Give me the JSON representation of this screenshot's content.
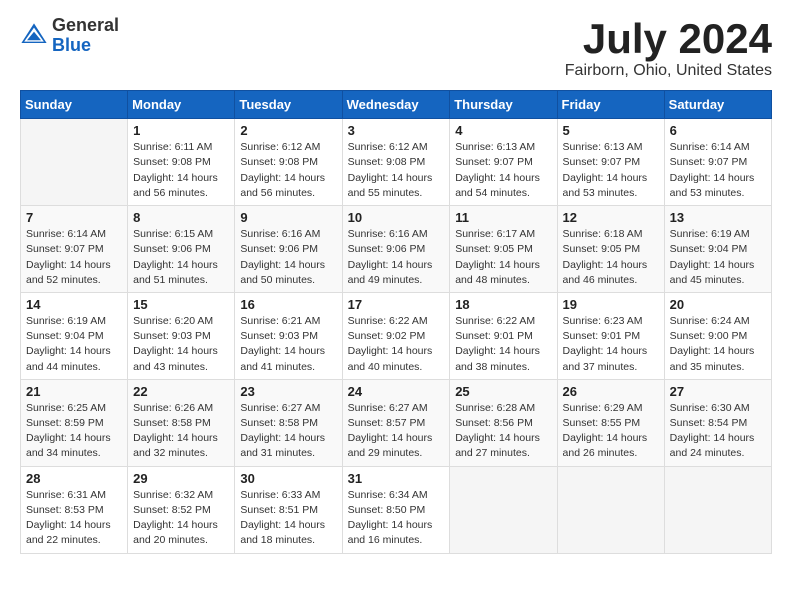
{
  "logo": {
    "text_general": "General",
    "text_blue": "Blue"
  },
  "header": {
    "month_year": "July 2024",
    "location": "Fairborn, Ohio, United States"
  },
  "columns": [
    "Sunday",
    "Monday",
    "Tuesday",
    "Wednesday",
    "Thursday",
    "Friday",
    "Saturday"
  ],
  "weeks": [
    [
      {
        "day": "",
        "sunrise": "",
        "sunset": "",
        "daylight": ""
      },
      {
        "day": "1",
        "sunrise": "Sunrise: 6:11 AM",
        "sunset": "Sunset: 9:08 PM",
        "daylight": "Daylight: 14 hours and 56 minutes."
      },
      {
        "day": "2",
        "sunrise": "Sunrise: 6:12 AM",
        "sunset": "Sunset: 9:08 PM",
        "daylight": "Daylight: 14 hours and 56 minutes."
      },
      {
        "day": "3",
        "sunrise": "Sunrise: 6:12 AM",
        "sunset": "Sunset: 9:08 PM",
        "daylight": "Daylight: 14 hours and 55 minutes."
      },
      {
        "day": "4",
        "sunrise": "Sunrise: 6:13 AM",
        "sunset": "Sunset: 9:07 PM",
        "daylight": "Daylight: 14 hours and 54 minutes."
      },
      {
        "day": "5",
        "sunrise": "Sunrise: 6:13 AM",
        "sunset": "Sunset: 9:07 PM",
        "daylight": "Daylight: 14 hours and 53 minutes."
      },
      {
        "day": "6",
        "sunrise": "Sunrise: 6:14 AM",
        "sunset": "Sunset: 9:07 PM",
        "daylight": "Daylight: 14 hours and 53 minutes."
      }
    ],
    [
      {
        "day": "7",
        "sunrise": "Sunrise: 6:14 AM",
        "sunset": "Sunset: 9:07 PM",
        "daylight": "Daylight: 14 hours and 52 minutes."
      },
      {
        "day": "8",
        "sunrise": "Sunrise: 6:15 AM",
        "sunset": "Sunset: 9:06 PM",
        "daylight": "Daylight: 14 hours and 51 minutes."
      },
      {
        "day": "9",
        "sunrise": "Sunrise: 6:16 AM",
        "sunset": "Sunset: 9:06 PM",
        "daylight": "Daylight: 14 hours and 50 minutes."
      },
      {
        "day": "10",
        "sunrise": "Sunrise: 6:16 AM",
        "sunset": "Sunset: 9:06 PM",
        "daylight": "Daylight: 14 hours and 49 minutes."
      },
      {
        "day": "11",
        "sunrise": "Sunrise: 6:17 AM",
        "sunset": "Sunset: 9:05 PM",
        "daylight": "Daylight: 14 hours and 48 minutes."
      },
      {
        "day": "12",
        "sunrise": "Sunrise: 6:18 AM",
        "sunset": "Sunset: 9:05 PM",
        "daylight": "Daylight: 14 hours and 46 minutes."
      },
      {
        "day": "13",
        "sunrise": "Sunrise: 6:19 AM",
        "sunset": "Sunset: 9:04 PM",
        "daylight": "Daylight: 14 hours and 45 minutes."
      }
    ],
    [
      {
        "day": "14",
        "sunrise": "Sunrise: 6:19 AM",
        "sunset": "Sunset: 9:04 PM",
        "daylight": "Daylight: 14 hours and 44 minutes."
      },
      {
        "day": "15",
        "sunrise": "Sunrise: 6:20 AM",
        "sunset": "Sunset: 9:03 PM",
        "daylight": "Daylight: 14 hours and 43 minutes."
      },
      {
        "day": "16",
        "sunrise": "Sunrise: 6:21 AM",
        "sunset": "Sunset: 9:03 PM",
        "daylight": "Daylight: 14 hours and 41 minutes."
      },
      {
        "day": "17",
        "sunrise": "Sunrise: 6:22 AM",
        "sunset": "Sunset: 9:02 PM",
        "daylight": "Daylight: 14 hours and 40 minutes."
      },
      {
        "day": "18",
        "sunrise": "Sunrise: 6:22 AM",
        "sunset": "Sunset: 9:01 PM",
        "daylight": "Daylight: 14 hours and 38 minutes."
      },
      {
        "day": "19",
        "sunrise": "Sunrise: 6:23 AM",
        "sunset": "Sunset: 9:01 PM",
        "daylight": "Daylight: 14 hours and 37 minutes."
      },
      {
        "day": "20",
        "sunrise": "Sunrise: 6:24 AM",
        "sunset": "Sunset: 9:00 PM",
        "daylight": "Daylight: 14 hours and 35 minutes."
      }
    ],
    [
      {
        "day": "21",
        "sunrise": "Sunrise: 6:25 AM",
        "sunset": "Sunset: 8:59 PM",
        "daylight": "Daylight: 14 hours and 34 minutes."
      },
      {
        "day": "22",
        "sunrise": "Sunrise: 6:26 AM",
        "sunset": "Sunset: 8:58 PM",
        "daylight": "Daylight: 14 hours and 32 minutes."
      },
      {
        "day": "23",
        "sunrise": "Sunrise: 6:27 AM",
        "sunset": "Sunset: 8:58 PM",
        "daylight": "Daylight: 14 hours and 31 minutes."
      },
      {
        "day": "24",
        "sunrise": "Sunrise: 6:27 AM",
        "sunset": "Sunset: 8:57 PM",
        "daylight": "Daylight: 14 hours and 29 minutes."
      },
      {
        "day": "25",
        "sunrise": "Sunrise: 6:28 AM",
        "sunset": "Sunset: 8:56 PM",
        "daylight": "Daylight: 14 hours and 27 minutes."
      },
      {
        "day": "26",
        "sunrise": "Sunrise: 6:29 AM",
        "sunset": "Sunset: 8:55 PM",
        "daylight": "Daylight: 14 hours and 26 minutes."
      },
      {
        "day": "27",
        "sunrise": "Sunrise: 6:30 AM",
        "sunset": "Sunset: 8:54 PM",
        "daylight": "Daylight: 14 hours and 24 minutes."
      }
    ],
    [
      {
        "day": "28",
        "sunrise": "Sunrise: 6:31 AM",
        "sunset": "Sunset: 8:53 PM",
        "daylight": "Daylight: 14 hours and 22 minutes."
      },
      {
        "day": "29",
        "sunrise": "Sunrise: 6:32 AM",
        "sunset": "Sunset: 8:52 PM",
        "daylight": "Daylight: 14 hours and 20 minutes."
      },
      {
        "day": "30",
        "sunrise": "Sunrise: 6:33 AM",
        "sunset": "Sunset: 8:51 PM",
        "daylight": "Daylight: 14 hours and 18 minutes."
      },
      {
        "day": "31",
        "sunrise": "Sunrise: 6:34 AM",
        "sunset": "Sunset: 8:50 PM",
        "daylight": "Daylight: 14 hours and 16 minutes."
      },
      {
        "day": "",
        "sunrise": "",
        "sunset": "",
        "daylight": ""
      },
      {
        "day": "",
        "sunrise": "",
        "sunset": "",
        "daylight": ""
      },
      {
        "day": "",
        "sunrise": "",
        "sunset": "",
        "daylight": ""
      }
    ]
  ]
}
